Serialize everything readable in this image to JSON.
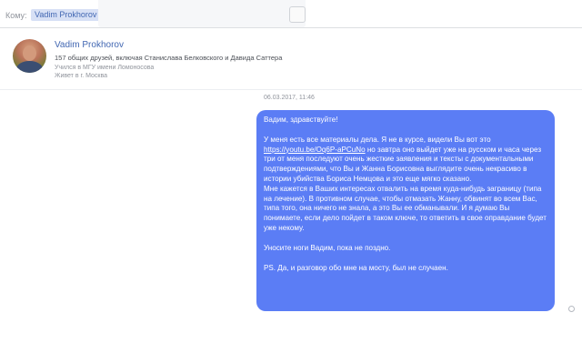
{
  "header": {
    "to_label": "Кому:",
    "recipient": "Vadim Prokhorov"
  },
  "profile": {
    "name": "Vadim Prokhorov",
    "friends": "157 общих друзей, включая Станислава Белковского и Давида Саттера",
    "education": "Учился в МГУ имени Ломоносова",
    "lives": "Живет в г. Москва"
  },
  "conversation": {
    "timestamp": "06.03.2017, 11:46",
    "message": {
      "greeting": "Вадим, здравствуйте!",
      "p1_before_link": "У меня есть все материалы дела. Я не в курсе, видели Вы вот это ",
      "link": "https://youtu.be/Oq6P-aPCuNo",
      "p1_after_link": " но завтра оно выйдет уже на русском и часа через три от меня последуют очень жесткие заявления и тексты с документальными подтверждениями, что Вы и Жанна Борисовна выглядите очень некрасиво в истории убийства Бориса Немцова и это еще мягко сказано.",
      "p2": "Мне кажется в Ваших интересах отвалить на время куда-нибудь заграницу (типа на лечение). В противном случае, чтобы отмазать Жанну, обвинят во всем Вас, типа того, она ничего не знала, а это Вы ее обманывали. И я думаю Вы понимаете, если дело пойдет в таком ключе, то ответить в свое оправдание будет уже некому.",
      "p3": "Уносите ноги Вадим, пока не поздно.",
      "p4": "PS. Да, и разговор обо мне на мосту, был не случаен."
    }
  },
  "colors": {
    "bubble": "#5b7df5",
    "link_name": "#4267b2"
  }
}
